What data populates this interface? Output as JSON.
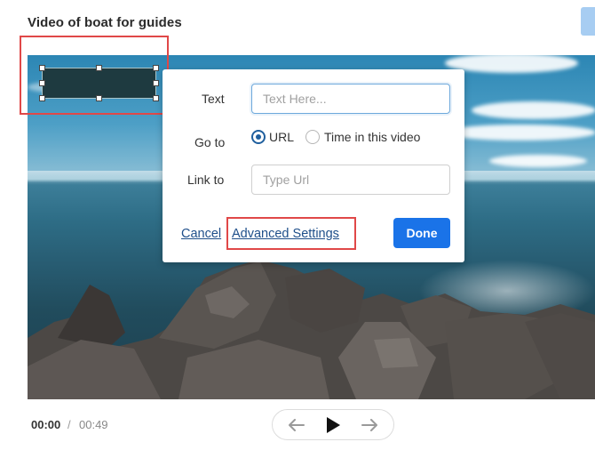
{
  "header": {
    "title": "Video of boat for guides"
  },
  "popup": {
    "text_label": "Text",
    "text_placeholder": "Text Here...",
    "goto_label": "Go to",
    "goto_options": [
      "URL",
      "Time in this video"
    ],
    "goto_selected": "URL",
    "link_label": "Link to",
    "link_placeholder": "Type Url",
    "cancel_label": "Cancel",
    "advanced_label": "Advanced Settings",
    "done_label": "Done"
  },
  "player": {
    "current_time": "00:00",
    "separator": "/",
    "duration": "00:49",
    "controls": [
      "arrow-left-icon",
      "play-icon",
      "arrow-right-icon"
    ]
  },
  "colors": {
    "accent": "#1a73e8",
    "highlight": "#e04848",
    "link": "#1f4f8a",
    "selection_fill": "#1e3a40"
  }
}
